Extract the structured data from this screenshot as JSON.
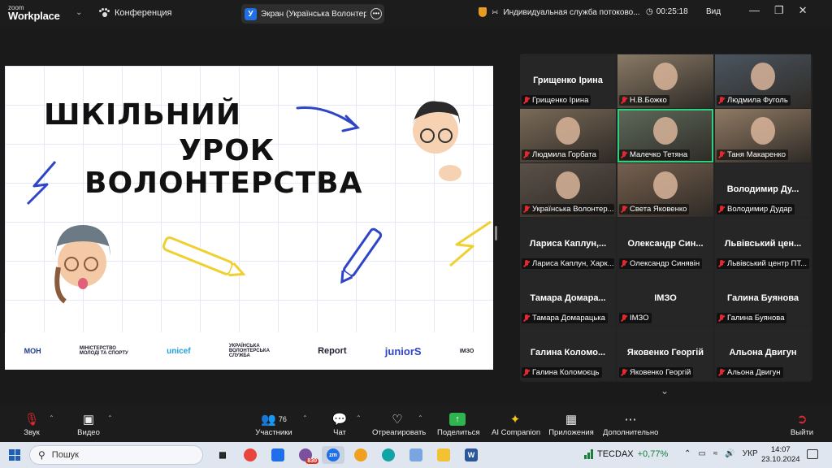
{
  "app": {
    "logo_top": "zoom",
    "logo_bottom": "Workplace",
    "meeting_name": "Конференция",
    "shared_screen_label": "Экран (Українська Волонтерсь",
    "stream_label": "Индивидуальная служба потоково...",
    "elapsed": "00:25:18",
    "view_label": "Вид"
  },
  "slide": {
    "title_line1": "ШКІЛЬНИЙ",
    "title_line2": "УРОК",
    "title_line3": "ВОЛОНТЕРСТВА",
    "logos": [
      "МОН",
      "МІНІСТЕРСТВО МОЛОДІ ТА СПОРТУ",
      "unicef",
      "УКРАЇНСЬКА ВОЛОНТЕРСЬКА СЛУЖБА",
      "Report",
      "juniorS",
      "ІМЗО"
    ]
  },
  "gallery": {
    "tiles": [
      {
        "name": "Грищенко Ірина",
        "label": "Грищенко Ірина",
        "video": false
      },
      {
        "name": "",
        "label": "Н.В.Божко",
        "video": true
      },
      {
        "name": "",
        "label": "Людмила Фуголь",
        "video": true
      },
      {
        "name": "",
        "label": "Людмила Горбата",
        "video": true
      },
      {
        "name": "",
        "label": "Малечко Тетяна",
        "video": true
      },
      {
        "name": "",
        "label": "Таня Макаренко",
        "video": true
      },
      {
        "name": "",
        "label": "Українська Волонтер...",
        "video": true
      },
      {
        "name": "",
        "label": "Света Яковенко",
        "video": true
      },
      {
        "name": "Володимир Ду...",
        "label": "Володимир Дудар",
        "video": false
      },
      {
        "name": "Лариса Каплун,...",
        "label": "Лариса Каплун, Харк...",
        "video": false
      },
      {
        "name": "Олександр Син...",
        "label": "Олександр Синявін",
        "video": false
      },
      {
        "name": "Львівський цен...",
        "label": "Львівський центр ПТ...",
        "video": false
      },
      {
        "name": "Тамара Домара...",
        "label": "Тамара Домарацька",
        "video": false
      },
      {
        "name": "ІМЗО",
        "label": "ІМЗО",
        "video": false
      },
      {
        "name": "Галина Буянова",
        "label": "Галина Буянова",
        "video": false
      },
      {
        "name": "Галина Коломо...",
        "label": "Галина Коломоєць",
        "video": false
      },
      {
        "name": "Яковенко Георгій",
        "label": "Яковенко Георгій",
        "video": false
      },
      {
        "name": "Альона Двигун",
        "label": "Альона Двигун",
        "video": false
      }
    ]
  },
  "toolbar": {
    "audio": "Звук",
    "video": "Видео",
    "participants": "Участники",
    "participants_count": "76",
    "chat": "Чат",
    "react": "Отреагировать",
    "share": "Поделиться",
    "ai": "AI Companion",
    "apps": "Приложения",
    "more": "Дополнительно",
    "leave": "Выйти"
  },
  "taskbar": {
    "search_placeholder": "Пошук",
    "viber_badge": "830",
    "ticker_name": "TECDAX",
    "ticker_change": "+0,77%",
    "lang": "УКР",
    "time": "14:07",
    "date": "23.10.2024"
  },
  "colors": {
    "active_speaker": "#2fd27a",
    "muted": "#e0292f",
    "share": "#2fb450"
  }
}
